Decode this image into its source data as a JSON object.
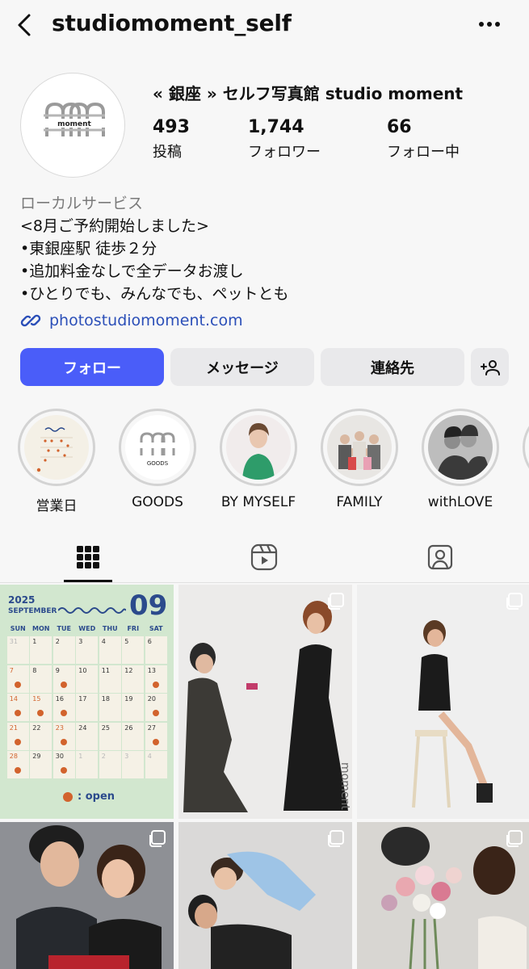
{
  "header": {
    "username": "studiomoment_self"
  },
  "profile": {
    "display_name": "« 銀座 » セルフ写真館 studio moment",
    "avatar_text": "moment",
    "stats": [
      {
        "value": "493",
        "label": "投稿"
      },
      {
        "value": "1,744",
        "label": "フォロワー"
      },
      {
        "value": "66",
        "label": "フォロー中"
      }
    ],
    "category": "ローカルサービス",
    "bio_lines": [
      "<8月ご予約開始しました>",
      "•東銀座駅 徒歩２分",
      "•追加料金なしで全データお渡し",
      "•ひとりでも、みんなでも、ペットとも"
    ],
    "link": "photostudiomoment.com"
  },
  "actions": {
    "follow": "フォロー",
    "message": "メッセージ",
    "contact": "連絡先"
  },
  "highlights": [
    {
      "label": "営業日"
    },
    {
      "label": "GOODS",
      "inner_text": "GOODS"
    },
    {
      "label": "BY MYSELF"
    },
    {
      "label": "FAMILY"
    },
    {
      "label": "withLOVE"
    }
  ],
  "calendar": {
    "year": "2025",
    "month_name": "SEPTEMBER",
    "month_num": "09",
    "weekdays": [
      "SUN",
      "MON",
      "TUE",
      "WED",
      "THU",
      "FRI",
      "SAT"
    ],
    "legend": ": open",
    "highlight_open": "open"
  },
  "post_watermark": "moment",
  "colors": {
    "follow_button": "#4a5df9",
    "link": "#2b4fb8",
    "calendar_blue": "#2b4a8c",
    "calendar_dot": "#d2632d"
  }
}
